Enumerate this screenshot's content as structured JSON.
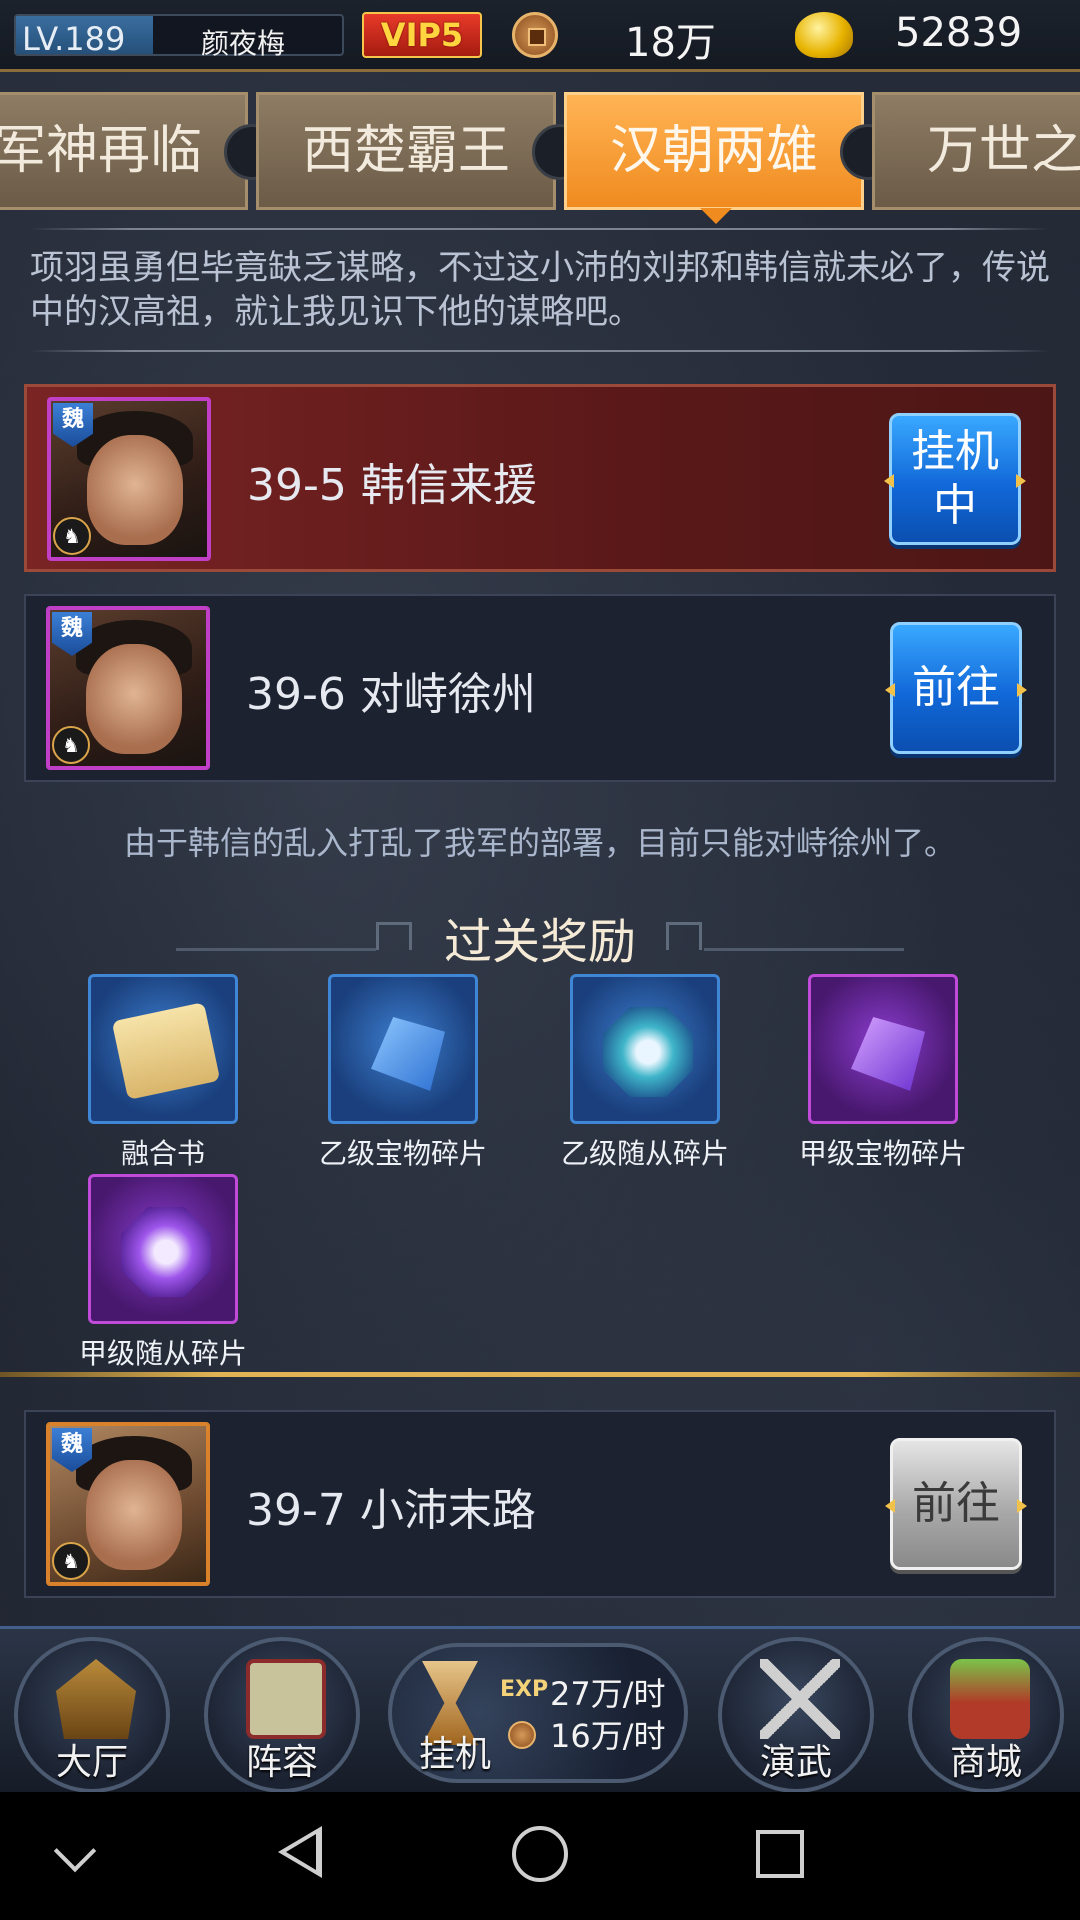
{
  "status_bar": {
    "level": "LV.189",
    "level_progress": 0.42,
    "player_name": "颜夜梅",
    "vip": "VIP5",
    "coins": "18万",
    "gold": "52839"
  },
  "chapter_tabs": [
    {
      "label": "军神再临",
      "active": false
    },
    {
      "label": "西楚霸王",
      "active": false
    },
    {
      "label": "汉朝两雄",
      "active": true
    },
    {
      "label": "万世之",
      "active": false
    }
  ],
  "intro_text": "项羽虽勇但毕竟缺乏谋略，不过这小沛的刘邦和韩信就未必了，传说中的汉高祖，就让我见识下他的谋略吧。",
  "stages": [
    {
      "title": "39-5  韩信来援",
      "faction": "魏",
      "button": "挂机中",
      "state": "current"
    },
    {
      "title": "39-6  对峙徐州",
      "faction": "魏",
      "button": "前往",
      "state": "available"
    },
    {
      "title": "39-7  小沛末路",
      "faction": "魏",
      "button": "前往",
      "state": "locked"
    }
  ],
  "stage_description": "由于韩信的乱入打乱了我军的部署，目前只能对峙徐州了。",
  "rewards_header": "过关奖励",
  "rewards": [
    {
      "label": "融合书",
      "icon": "scroll-icon",
      "rarity": "blue"
    },
    {
      "label": "乙级宝物碎片",
      "icon": "treasure-shard-icon",
      "rarity": "blue"
    },
    {
      "label": "乙级随从碎片",
      "icon": "follower-shard-icon",
      "rarity": "blue"
    },
    {
      "label": "甲级宝物碎片",
      "icon": "treasure-shard-icon",
      "rarity": "purple"
    },
    {
      "label": "甲级随从碎片",
      "icon": "follower-shard-icon",
      "rarity": "purple"
    }
  ],
  "bottom_nav": {
    "hall": "大厅",
    "lineup": "阵容",
    "idle": "挂机",
    "exp_tag": "EXP",
    "exp_rate": "27万/时",
    "coin_rate": "16万/时",
    "duel": "演武",
    "shop": "商城"
  },
  "colors": {
    "active_tab": "#f08b1f",
    "current_stage": "#7a2424",
    "go_button": "#1168d8",
    "locked_button": "#a9a9a9",
    "purple_rarity": "#bf4bd8",
    "blue_rarity": "#3f86d6"
  }
}
